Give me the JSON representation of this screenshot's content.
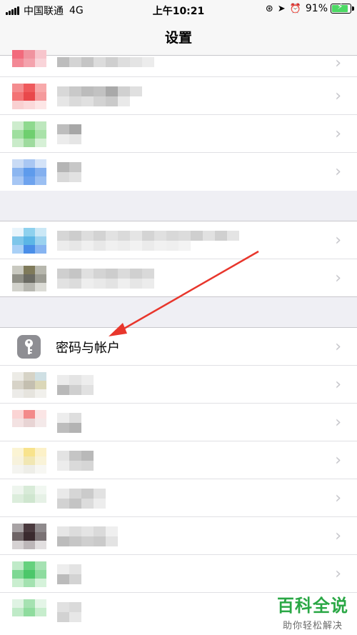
{
  "statusbar": {
    "carrier": "中国联通",
    "network": "4G",
    "time": "上午10:21",
    "battery": "91%",
    "battery_level": 0.91,
    "icons": [
      "orientation-lock-icon",
      "location-icon",
      "alarm-icon",
      "battery-icon"
    ]
  },
  "nav": {
    "title": "设置"
  },
  "passwords_row": {
    "label": "密码与帐户",
    "icon": "key-icon"
  },
  "chevron": "›",
  "watermark": {
    "title": "百科全说",
    "subtitle": "助你轻松解决"
  },
  "colors": {
    "arrow": "#e8362c",
    "watermark": "#2aa745",
    "settings_icon_gray": "#8e8e93",
    "background": "#efeff4"
  }
}
